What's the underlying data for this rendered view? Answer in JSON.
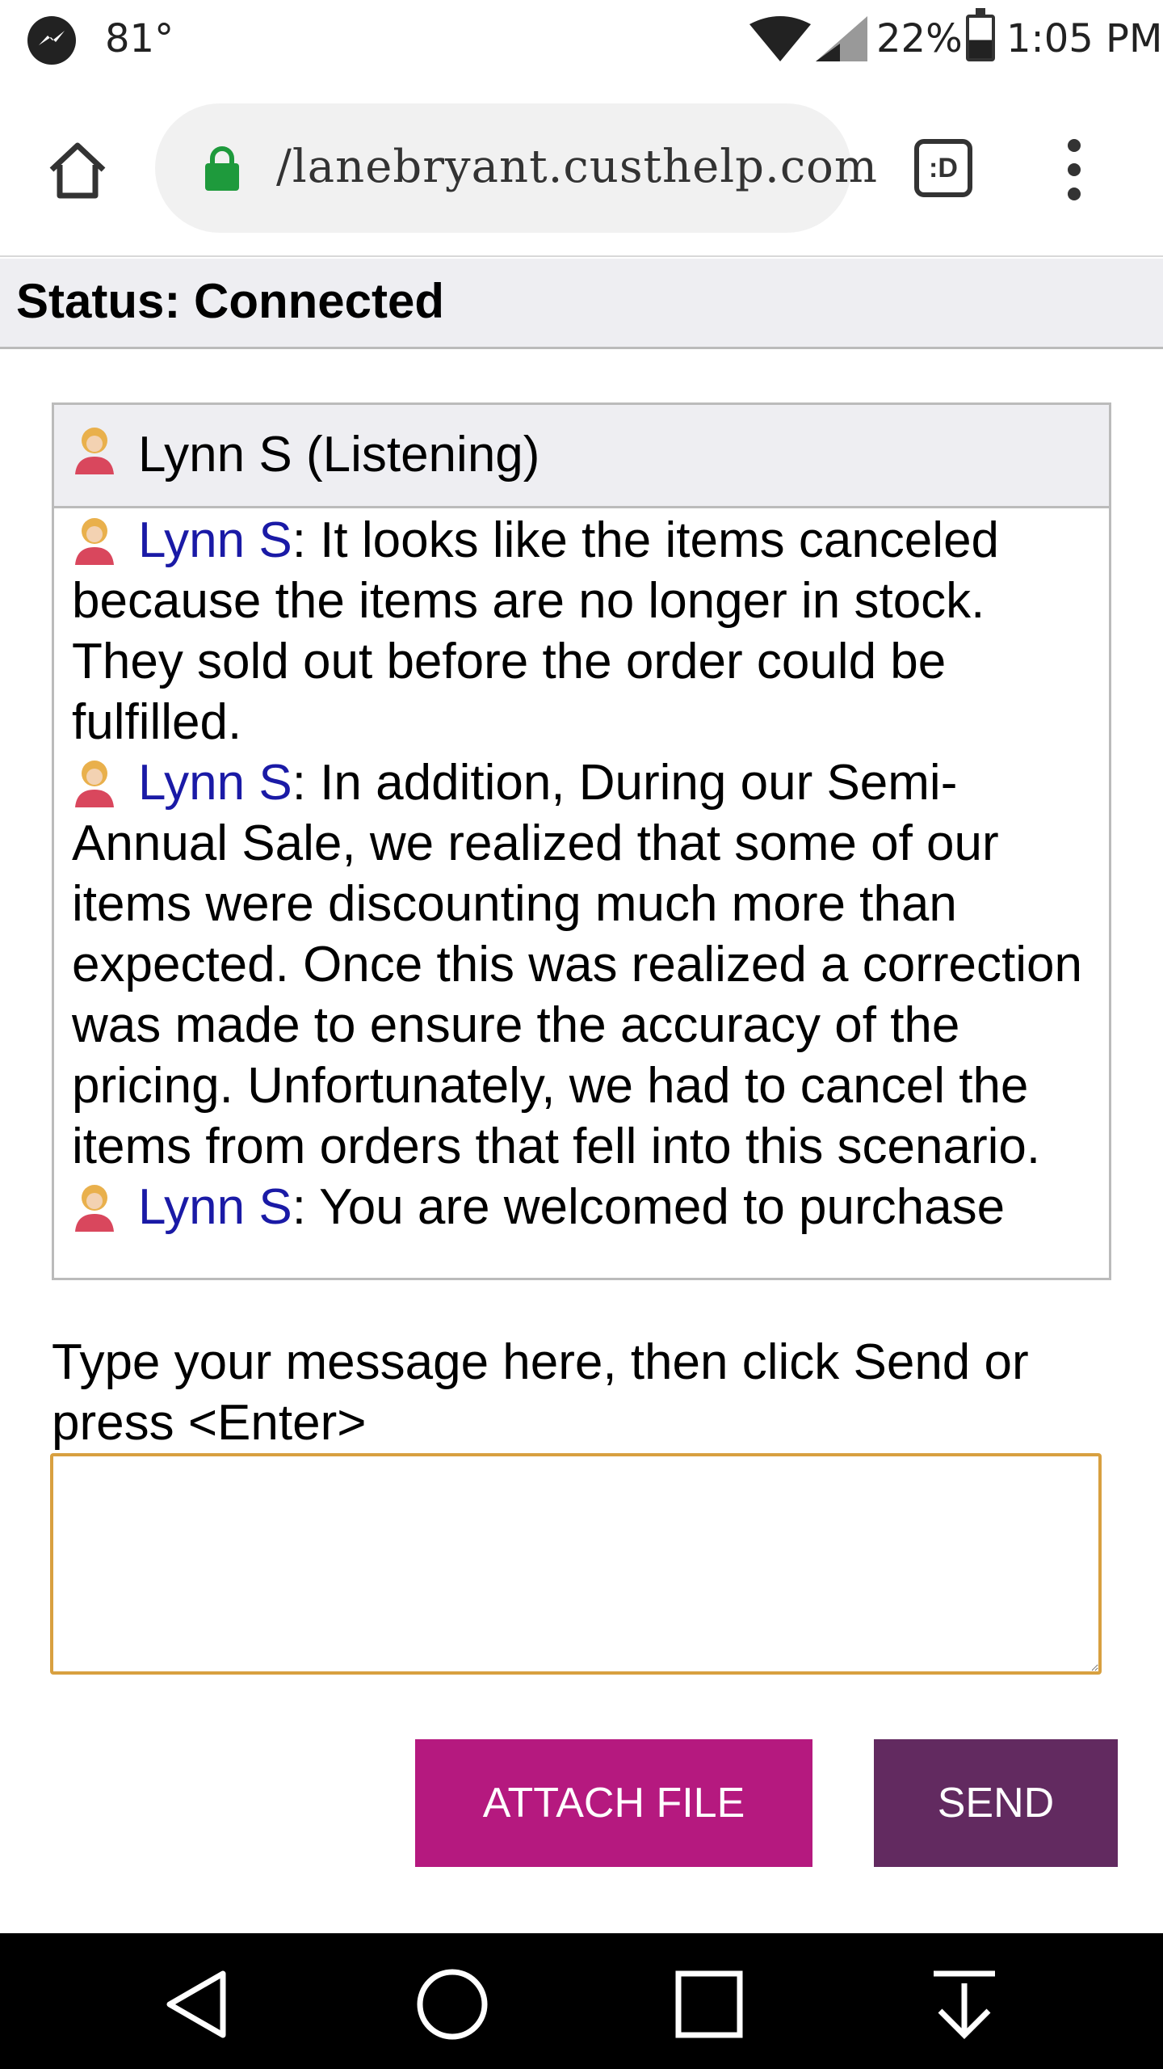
{
  "status_bar": {
    "temperature": "81°",
    "battery_percent": "22%",
    "time": "1:05 PM"
  },
  "browser": {
    "url": "/lanebryant.custhelp.com",
    "tab_switcher_label": ":D"
  },
  "chat": {
    "status": "Status: Connected",
    "roster_name": "Lynn S (Listening)",
    "messages": [
      {
        "author": "Lynn S",
        "text": ": It looks like the items canceled because the items are no longer in stock. They sold out before the order could be fulfilled."
      },
      {
        "author": "Lynn S",
        "text": ": In addition, During our Semi-Annual Sale, we realized that some of our items were discounting much more than expected. Once this was realized a correction was made to ensure the accuracy of the pricing. Unfortunately, we had to cancel the items from orders that fell into this scenario."
      },
      {
        "author": "Lynn S",
        "text": ": You are welcomed to purchase"
      }
    ]
  },
  "composer": {
    "label": "Type your message here, then click Send or press <Enter>",
    "value": "",
    "attach_label": "ATTACH FILE",
    "send_label": "SEND"
  },
  "colors": {
    "attach_button": "#b5197f",
    "send_button": "#622a60",
    "author_link": "#1a1aa6",
    "input_border": "#d8a040"
  }
}
